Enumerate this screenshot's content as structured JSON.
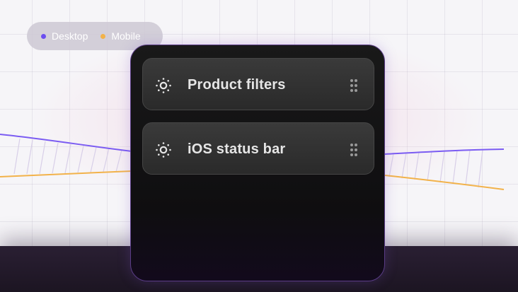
{
  "legend": {
    "items": [
      {
        "label": "Desktop",
        "color": "#6b4ef0"
      },
      {
        "label": "Mobile",
        "color": "#f2b24a"
      }
    ]
  },
  "panel": {
    "cards": [
      {
        "label": "Product filters",
        "icon": "sun-icon"
      },
      {
        "label": "iOS status bar",
        "icon": "sun-icon"
      }
    ]
  },
  "colors": {
    "desktop_line": "#7b5cf2",
    "mobile_line": "#f2b24a",
    "panel_border": "#5a3c86"
  }
}
